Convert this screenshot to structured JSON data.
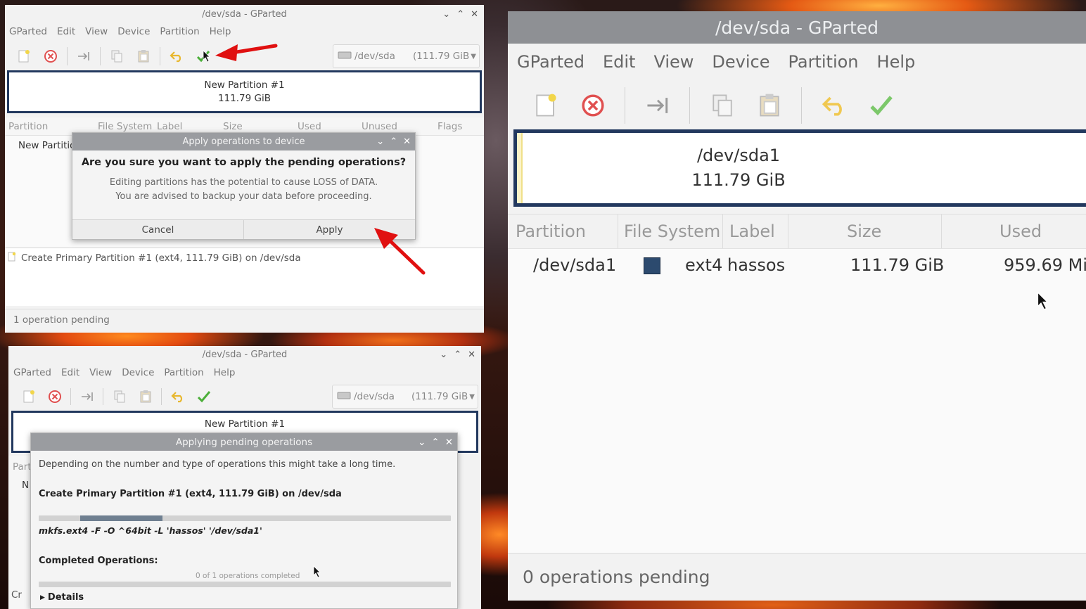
{
  "window_a": {
    "title": "/dev/sda - GParted",
    "menu": [
      "GParted",
      "Edit",
      "View",
      "Device",
      "Partition",
      "Help"
    ],
    "device_name": "/dev/sda",
    "device_size": "(111.79 GiB",
    "partbar_name": "New Partition #1",
    "partbar_size": "111.79 GiB",
    "columns": [
      "Partition",
      "File System",
      "Label",
      "Size",
      "Used",
      "Unused",
      "Flags"
    ],
    "row_partition": "New Partitio",
    "operation": "Create Primary Partition #1 (ext4, 111.79 GiB) on /dev/sda",
    "status": "1 operation pending"
  },
  "dialog_a": {
    "title": "Apply operations to device",
    "heading": "Are you sure you want to apply the pending operations?",
    "body_line1": "Editing partitions has the potential to cause LOSS of DATA.",
    "body_line2": "You are advised to backup your data before proceeding.",
    "cancel_label": "Cancel",
    "apply_label": "Apply"
  },
  "window_b": {
    "title": "/dev/sda - GParted",
    "menu": [
      "GParted",
      "Edit",
      "View",
      "Device",
      "Partition",
      "Help"
    ],
    "device_name": "/dev/sda",
    "device_size": "(111.79 GiB",
    "partbar_name": "New Partition #1",
    "side_col": "Part",
    "side_row": "N",
    "side_op": "Cr"
  },
  "dialog_b": {
    "title": "Applying pending operations",
    "intro": "Depending on the number and type of operations this might take a long time.",
    "current_op": "Create Primary Partition #1 (ext4, 111.79 GiB) on /dev/sda",
    "command": "mkfs.ext4 -F -O ^64bit -L 'hassos' '/dev/sda1'",
    "completed_label": "Completed Operations:",
    "completed_count": "0 of 1 operations completed",
    "details_label": "Details",
    "progress_fraction": 0.2
  },
  "window_c": {
    "title": "/dev/sda - GParted",
    "menu": [
      "GParted",
      "Edit",
      "View",
      "Device",
      "Partition",
      "Help"
    ],
    "partbar_name": "/dev/sda1",
    "partbar_size": "111.79 GiB",
    "columns": [
      "Partition",
      "File System",
      "Label",
      "Size",
      "Used"
    ],
    "row": {
      "partition": "/dev/sda1",
      "filesystem": "ext4",
      "fs_color": "#2c4a6e",
      "label": "hassos",
      "size": "111.79 GiB",
      "used": "959.69 MiB"
    },
    "status": "0 operations pending"
  },
  "colors": {
    "accent_border": "#22385e",
    "dialog_title": "#9a9ca0",
    "apply_check": "#4caf3a",
    "delete_red": "#e05050",
    "annotation_arrow": "#e01010"
  },
  "icons": [
    "new-icon",
    "delete-icon",
    "resize-icon",
    "copy-icon",
    "paste-icon",
    "undo-icon",
    "apply-icon",
    "drive-icon",
    "cursor-icon",
    "annotation-arrow"
  ]
}
